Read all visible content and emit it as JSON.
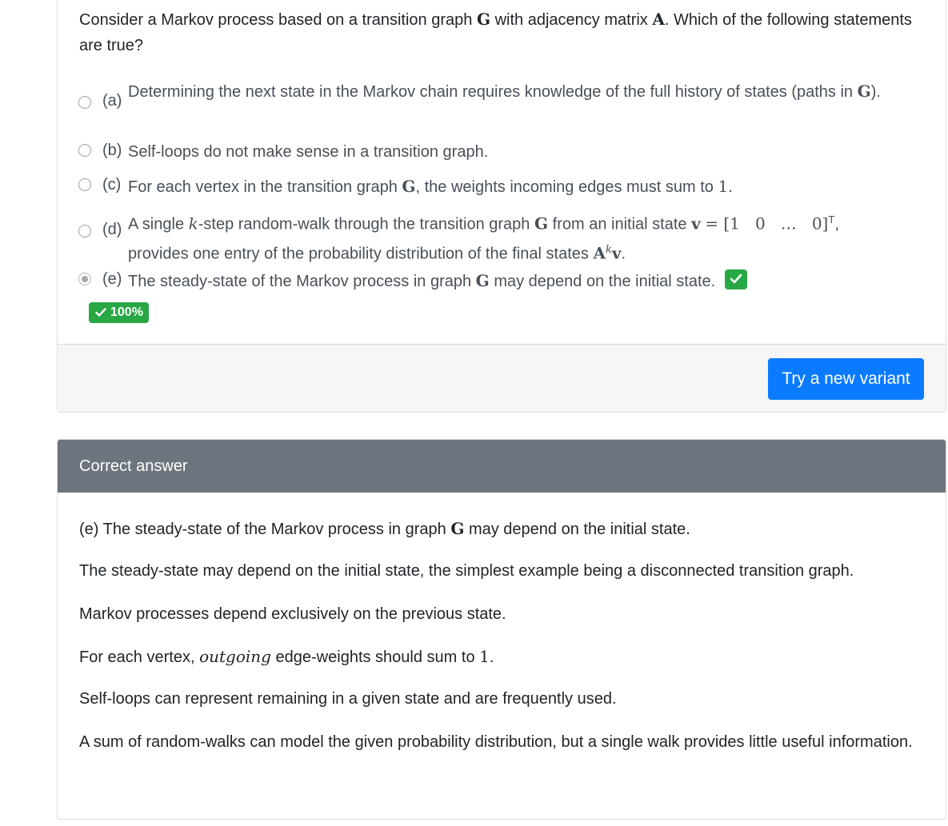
{
  "question": {
    "text_a": "Consider a Markov process based on a transition graph",
    "sym_g": "G",
    "text_b": "with adjacency matrix",
    "sym_a": "A",
    "text_c": ". Which of the following statements are true?"
  },
  "options": {
    "a": {
      "label": "(a)",
      "text_a": "Determining the next state in the Markov chain requires knowledge of the full history of states (paths in",
      "sym": "G",
      "text_b": ").",
      "selected": false
    },
    "b": {
      "label": "(b)",
      "text": "Self-loops do not make sense in a transition graph.",
      "selected": false
    },
    "c": {
      "label": "(c)",
      "text_a": "For each vertex in the transition graph",
      "sym": "G",
      "text_b": ", the weights incoming edges must sum to",
      "num": "1",
      "text_c": ".",
      "selected": false
    },
    "d": {
      "label": "(d)",
      "text_a": "A single",
      "sym_k": "k",
      "text_b": "-step random-walk through the transition graph",
      "sym_g": "G",
      "text_c": "from an initial state",
      "sym_v": "v",
      "vector": "= [1   0   …   0]",
      "sup_t": "T",
      "text_d": ",",
      "text_e": "provides one entry of the probability distribution of the final states",
      "sym_ak": "A",
      "sup_k": "k",
      "sym_v2": "v",
      "text_f": ".",
      "selected": false
    },
    "e": {
      "label": "(e)",
      "text_a": "The steady-state of the Markov process in graph",
      "sym": "G",
      "text_b": "may depend on the initial state.",
      "selected": true,
      "correct_icon": "check-icon"
    }
  },
  "score_badge": "100%",
  "footer": {
    "button_label": "Try a new variant"
  },
  "correct_answer": {
    "header": "Correct answer",
    "answer_text_a": "(e) The steady-state of the Markov process in graph",
    "answer_sym": "G",
    "answer_text_b": "may depend on the initial state.",
    "explanation_1": "The steady-state may depend on the initial state, the simplest example being a disconnected transition graph.",
    "explanation_2": "Markov processes depend exclusively on the previous state.",
    "explanation_3_a": "For each vertex,",
    "explanation_3_em": "outgoing",
    "explanation_3_b": "edge-weights should sum to",
    "explanation_3_num": "1",
    "explanation_3_c": ".",
    "explanation_4": "Self-loops can represent remaining in a given state and are frequently used.",
    "explanation_5": "A sum of random-walks can model the given probability distribution, but a single walk provides little useful information."
  },
  "colors": {
    "success": "#28a745",
    "primary": "#0a7bff",
    "header_gray": "#6c757d",
    "footer_bg": "#f6f6f6"
  }
}
